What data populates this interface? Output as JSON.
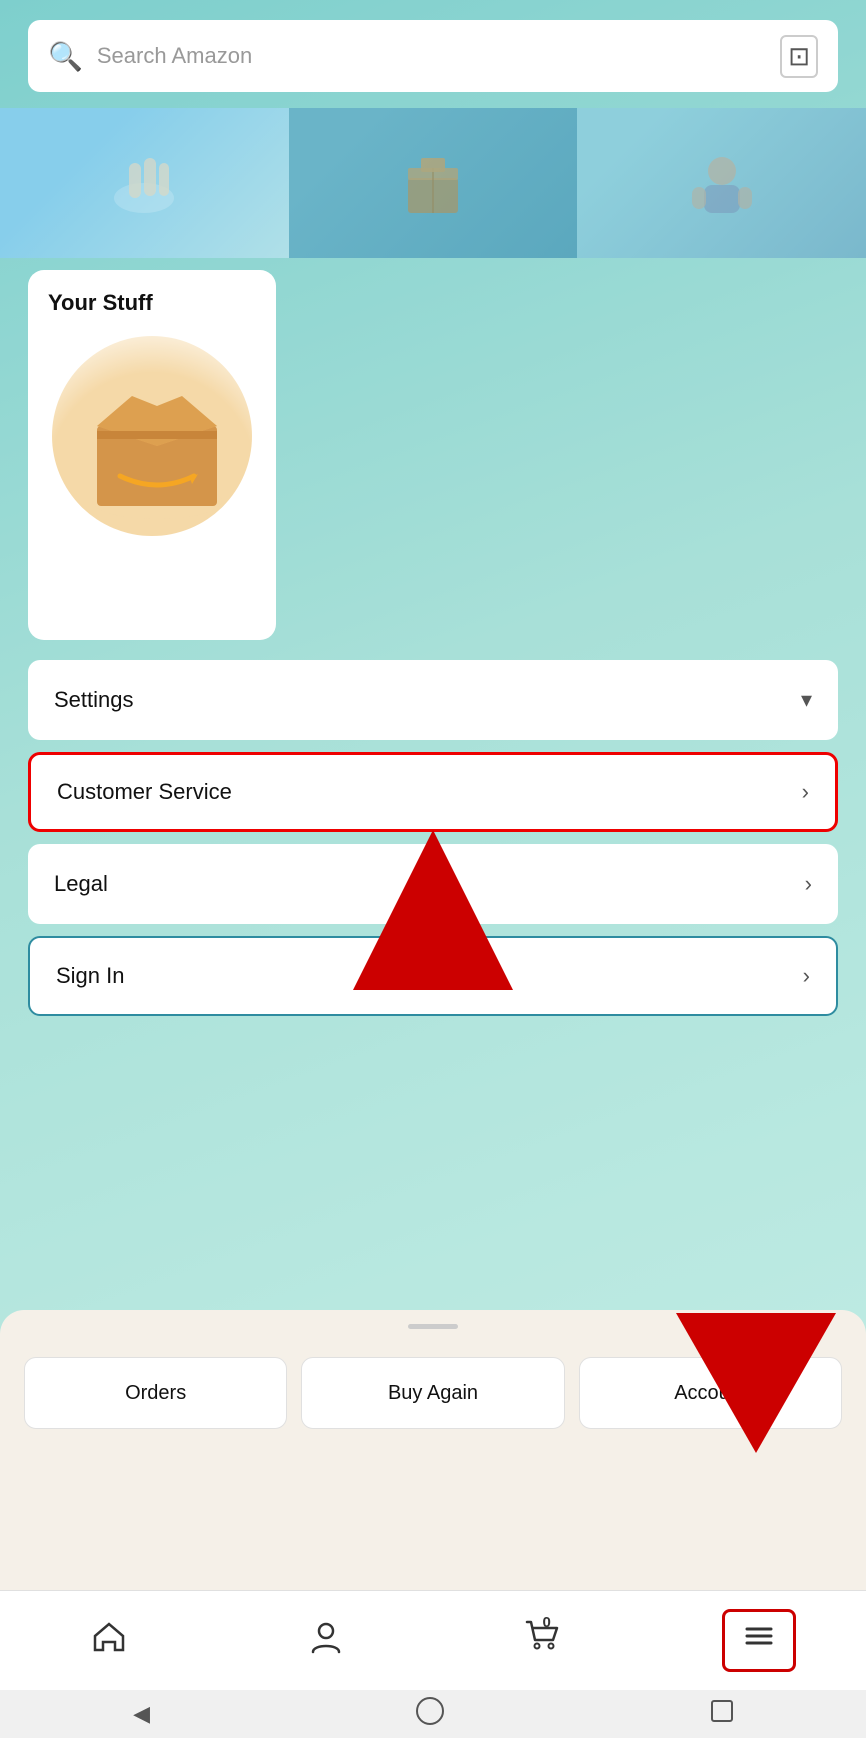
{
  "search": {
    "placeholder": "Search Amazon"
  },
  "your_stuff": {
    "title": "Your Stuff"
  },
  "menu_items": [
    {
      "id": "settings",
      "label": "Settings",
      "chevron": "▾",
      "highlighted": false,
      "sign_in": false
    },
    {
      "id": "customer-service",
      "label": "Customer Service",
      "chevron": "›",
      "highlighted": true,
      "sign_in": false
    },
    {
      "id": "legal",
      "label": "Legal",
      "chevron": "›",
      "highlighted": false,
      "sign_in": false
    },
    {
      "id": "sign-in",
      "label": "Sign In",
      "chevron": "›",
      "highlighted": false,
      "sign_in": true
    }
  ],
  "bottom_sheet": {
    "buttons": [
      {
        "id": "orders",
        "label": "Orders"
      },
      {
        "id": "buy-again",
        "label": "Buy Again"
      },
      {
        "id": "account",
        "label": "Account"
      }
    ]
  },
  "bottom_nav": {
    "items": [
      {
        "id": "home",
        "icon": "⌂",
        "label": ""
      },
      {
        "id": "account",
        "icon": "👤",
        "label": ""
      },
      {
        "id": "cart",
        "icon": "🛒",
        "badge": "0",
        "label": ""
      },
      {
        "id": "menu",
        "icon": "≡",
        "label": "",
        "active": true
      }
    ]
  },
  "android_nav": {
    "back": "◀",
    "home_circle": "",
    "recent": ""
  },
  "colors": {
    "highlight_red": "#cc0000",
    "sign_in_blue": "#2e8ca0",
    "background_teal": "#7ecfcd"
  }
}
